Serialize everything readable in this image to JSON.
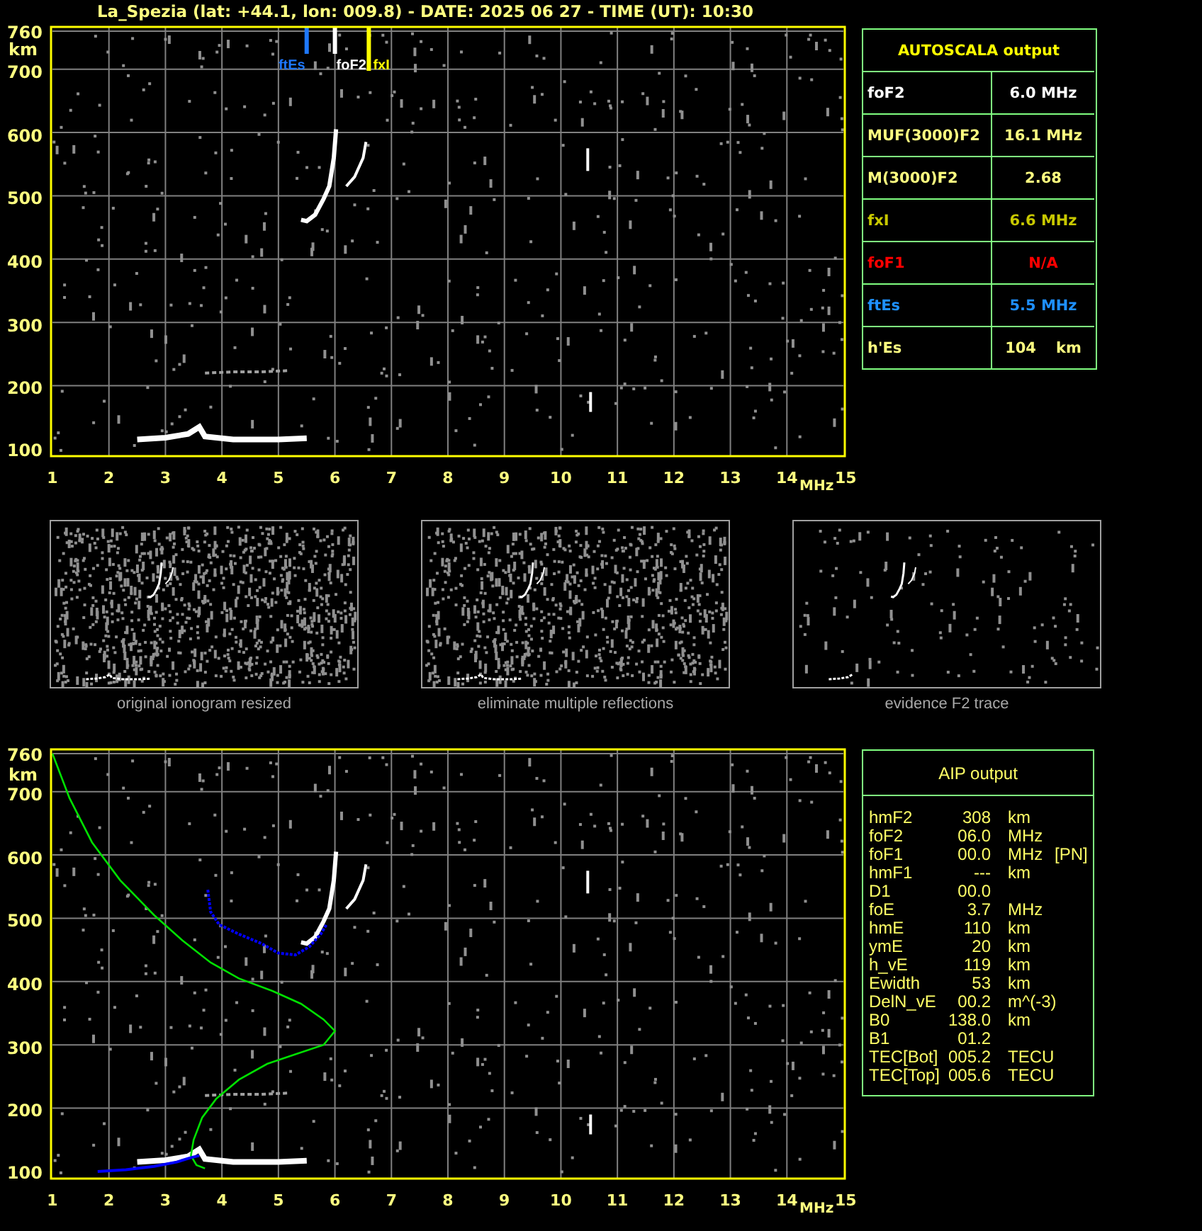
{
  "title": "La_Spezia (lat: +44.1, lon: 009.8) - DATE: 2025 06 27 - TIME (UT): 10:30",
  "autoscala_ionogram": {
    "kind": "autoscala",
    "y_labels": [
      "760",
      "700",
      "600",
      "500",
      "400",
      "300",
      "200",
      "100"
    ],
    "y_unit": "km",
    "x_labels": [
      "1",
      "2",
      "3",
      "4",
      "5",
      "6",
      "7",
      "8",
      "9",
      "10",
      "11",
      "12",
      "13",
      "14",
      "15"
    ],
    "x_unit": "MHz",
    "markers": [
      {
        "label": "ftEs",
        "color": "#1e78ff"
      },
      {
        "label": "foF2",
        "color": "#ffffff"
      },
      {
        "label": "fxI",
        "color": "#ffff00"
      }
    ]
  },
  "autoscala": {
    "title": "AUTOSCALA output",
    "rows": [
      {
        "name": "foF2",
        "value": "6.0 MHz",
        "color": "#ffffff"
      },
      {
        "name": "MUF(3000)F2",
        "value": "16.1 MHz",
        "color": "#ffff80"
      },
      {
        "name": "M(3000)F2",
        "value": "2.68",
        "color": "#ffff80"
      },
      {
        "name": "fxI",
        "value": "6.6 MHz",
        "color": "#c8c800"
      },
      {
        "name": "foF1",
        "value": "N/A",
        "color": "#ff0000"
      },
      {
        "name": "ftEs",
        "value": "5.5 MHz",
        "color": "#1e90ff"
      },
      {
        "name": "h'Es",
        "value": "104",
        "unit": "km",
        "color": "#ffff80"
      }
    ]
  },
  "thumbnails": [
    {
      "kind": "original",
      "caption": "original ionogram resized"
    },
    {
      "kind": "filtered",
      "caption": "eliminate multiple reflections"
    },
    {
      "kind": "trace",
      "caption": "evidence F2 trace"
    }
  ],
  "aip_ionogram": {
    "kind": "aip",
    "y_labels": [
      "760",
      "700",
      "600",
      "500",
      "400",
      "300",
      "200",
      "100"
    ],
    "y_unit": "km",
    "x_labels": [
      "1",
      "2",
      "3",
      "4",
      "5",
      "6",
      "7",
      "8",
      "9",
      "10",
      "11",
      "12",
      "13",
      "14",
      "15"
    ],
    "x_unit": "MHz"
  },
  "aip": {
    "title": "AIP output",
    "rows": [
      {
        "name": "hmF2",
        "value": "308",
        "unit": "km"
      },
      {
        "name": "foF2",
        "value": "06.0",
        "unit": "MHz"
      },
      {
        "name": "foF1",
        "value": "00.0",
        "unit": "MHz",
        "note": "[PN]"
      },
      {
        "name": "hmF1",
        "value": "---",
        "unit": "km"
      },
      {
        "name": "D1",
        "value": "00.0"
      },
      {
        "name": "foE",
        "value": "3.7",
        "unit": "MHz"
      },
      {
        "name": "hmE",
        "value": "110",
        "unit": "km"
      },
      {
        "name": "ymE",
        "value": "20",
        "unit": "km"
      },
      {
        "name": "h_vE",
        "value": "119",
        "unit": "km"
      },
      {
        "name": "Ewidth",
        "value": "53",
        "unit": "km"
      },
      {
        "name": "DelN_vE",
        "value": "00.2",
        "unit": "m^(-3)"
      },
      {
        "name": "B0",
        "value": "138.0",
        "unit": "km"
      },
      {
        "name": "B1",
        "value": "01.2"
      },
      {
        "name": "TEC[Bot]",
        "value": "005.2",
        "unit": "TECU"
      },
      {
        "name": "TEC[Top]",
        "value": "005.6",
        "unit": "TECU"
      }
    ]
  }
}
